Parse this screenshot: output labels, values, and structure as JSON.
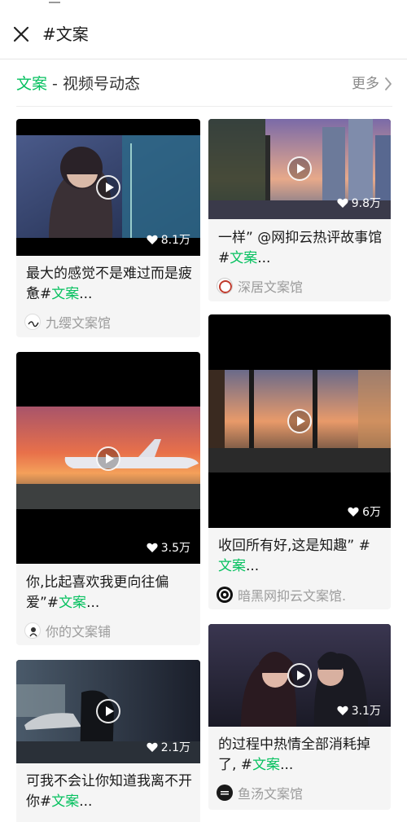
{
  "header": {
    "title": "#文案",
    "close_icon": "close-icon"
  },
  "section": {
    "keyword": "文案",
    "title_rest": " - 视频号动态",
    "more_label": "更多",
    "more_icon": "chevron-right-icon"
  },
  "colors": {
    "accent": "#07c160",
    "card_bg": "#f5f5f5",
    "author_gray": "#9b9b9b"
  },
  "cards": [
    {
      "likes": "8.1万",
      "caption_pre": "最大的感觉不是难过而是疲惫#",
      "caption_tag": "文案",
      "caption_post": "...",
      "author": "九缨文案馆"
    },
    {
      "likes": "9.8万",
      "caption_pre": "一样” @网抑云热评故事馆#",
      "caption_tag": "文案",
      "caption_post": "...",
      "author": "深居文案馆"
    },
    {
      "likes": "3.5万",
      "caption_pre": "你,比起喜欢我更向往偏爱”#",
      "caption_tag": "文案",
      "caption_post": "...",
      "author": "你的文案铺"
    },
    {
      "likes": "6万",
      "caption_pre": "收回所有好,这是知趣” #",
      "caption_tag": "文案",
      "caption_post": "...",
      "author": "暗黑网抑云文案馆."
    },
    {
      "likes": "2.1万",
      "caption_pre": "可我不会让你知道我离不开你#",
      "caption_tag": "文案",
      "caption_post": "...",
      "author": ""
    },
    {
      "likes": "3.1万",
      "caption_pre": "的过程中热情全部消耗掉了, #",
      "caption_tag": "文案",
      "caption_post": "...",
      "author": "鱼汤文案馆"
    }
  ]
}
